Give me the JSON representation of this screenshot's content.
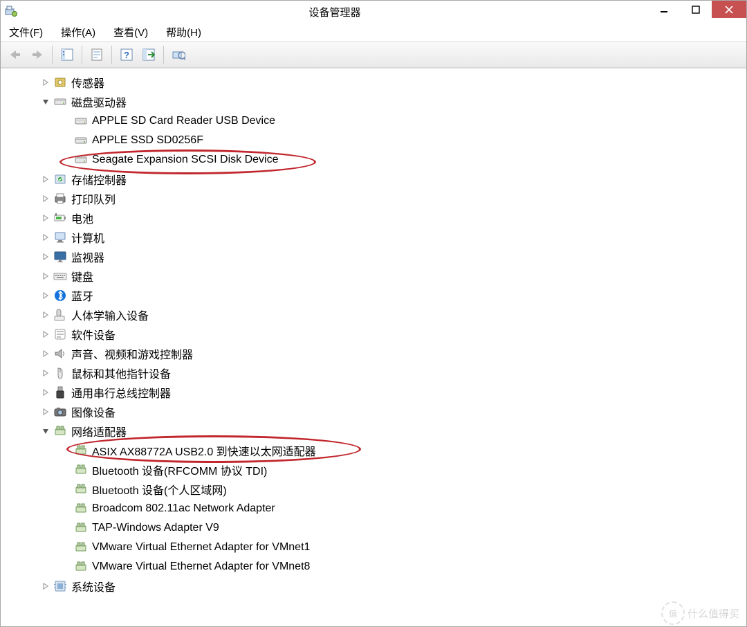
{
  "window": {
    "title": "设备管理器"
  },
  "menu": {
    "file": "文件(F)",
    "action": "操作(A)",
    "view": "查看(V)",
    "help": "帮助(H)"
  },
  "tree": [
    {
      "id": "sensors",
      "label": "传感器",
      "icon": "sensor",
      "exp": "right",
      "depth": 1
    },
    {
      "id": "disks",
      "label": "磁盘驱动器",
      "icon": "disk",
      "exp": "down",
      "depth": 1
    },
    {
      "id": "d1",
      "label": "APPLE SD Card Reader USB Device",
      "icon": "disk",
      "exp": "",
      "depth": 2
    },
    {
      "id": "d2",
      "label": "APPLE SSD SD0256F",
      "icon": "disk",
      "exp": "",
      "depth": 2
    },
    {
      "id": "d3",
      "label": "Seagate Expansion SCSI Disk Device",
      "icon": "disk",
      "exp": "",
      "depth": 2
    },
    {
      "id": "storage",
      "label": "存储控制器",
      "icon": "storage",
      "exp": "right",
      "depth": 1
    },
    {
      "id": "printers",
      "label": "打印队列",
      "icon": "printer",
      "exp": "right",
      "depth": 1
    },
    {
      "id": "battery",
      "label": "电池",
      "icon": "battery",
      "exp": "right",
      "depth": 1
    },
    {
      "id": "computer",
      "label": "计算机",
      "icon": "computer",
      "exp": "right",
      "depth": 1
    },
    {
      "id": "monitor",
      "label": "监视器",
      "icon": "monitor",
      "exp": "right",
      "depth": 1
    },
    {
      "id": "keyboard",
      "label": "键盘",
      "icon": "keyboard",
      "exp": "right",
      "depth": 1
    },
    {
      "id": "bluetooth",
      "label": "蓝牙",
      "icon": "bt",
      "exp": "right",
      "depth": 1
    },
    {
      "id": "hid",
      "label": "人体学输入设备",
      "icon": "hid",
      "exp": "right",
      "depth": 1
    },
    {
      "id": "software",
      "label": "软件设备",
      "icon": "soft",
      "exp": "right",
      "depth": 1
    },
    {
      "id": "sound",
      "label": "声音、视频和游戏控制器",
      "icon": "sound",
      "exp": "right",
      "depth": 1
    },
    {
      "id": "mouse",
      "label": "鼠标和其他指针设备",
      "icon": "mouse",
      "exp": "right",
      "depth": 1
    },
    {
      "id": "usb",
      "label": "通用串行总线控制器",
      "icon": "usb",
      "exp": "right",
      "depth": 1
    },
    {
      "id": "imaging",
      "label": "图像设备",
      "icon": "imaging",
      "exp": "right",
      "depth": 1
    },
    {
      "id": "network",
      "label": "网络适配器",
      "icon": "net",
      "exp": "down",
      "depth": 1
    },
    {
      "id": "n1",
      "label": "ASIX AX88772A USB2.0 到快速以太网适配器",
      "icon": "net",
      "exp": "",
      "depth": 2
    },
    {
      "id": "n2",
      "label": "Bluetooth 设备(RFCOMM 协议 TDI)",
      "icon": "net",
      "exp": "",
      "depth": 2
    },
    {
      "id": "n3",
      "label": "Bluetooth 设备(个人区域网)",
      "icon": "net",
      "exp": "",
      "depth": 2
    },
    {
      "id": "n4",
      "label": "Broadcom 802.11ac Network Adapter",
      "icon": "net",
      "exp": "",
      "depth": 2
    },
    {
      "id": "n5",
      "label": "TAP-Windows Adapter V9",
      "icon": "net",
      "exp": "",
      "depth": 2
    },
    {
      "id": "n6",
      "label": "VMware Virtual Ethernet Adapter for VMnet1",
      "icon": "net",
      "exp": "",
      "depth": 2
    },
    {
      "id": "n7",
      "label": "VMware Virtual Ethernet Adapter for VMnet8",
      "icon": "net",
      "exp": "",
      "depth": 2
    },
    {
      "id": "system",
      "label": "系统设备",
      "icon": "system",
      "exp": "right",
      "depth": 1
    }
  ],
  "watermark": "什么值得买"
}
